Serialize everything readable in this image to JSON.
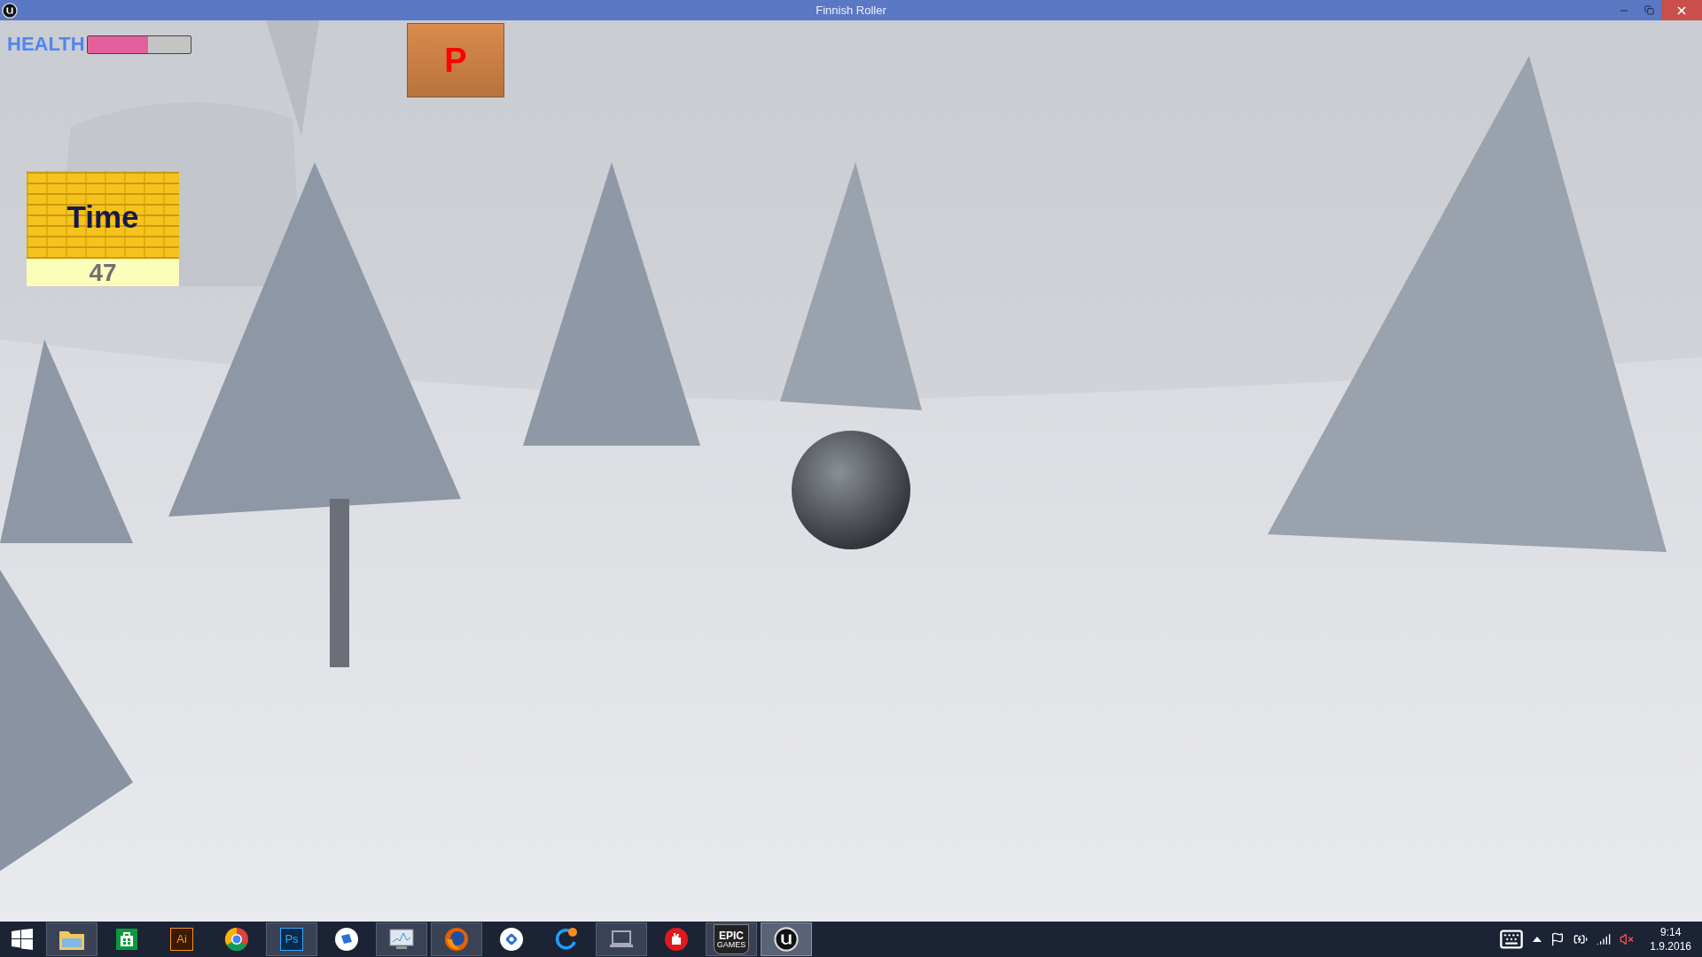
{
  "window": {
    "title": "Finnish Roller"
  },
  "hud": {
    "health": {
      "label": "HEALTH",
      "level": 0.59
    },
    "pause_button": {
      "label": "P"
    },
    "timer": {
      "label": "Time",
      "value": "47"
    }
  },
  "taskbar": {
    "apps": [
      {
        "kind": "folder",
        "running": true
      },
      {
        "kind": "store",
        "running": false
      },
      {
        "kind": "illustrator",
        "label": "Ai",
        "running": false
      },
      {
        "kind": "chrome",
        "running": false
      },
      {
        "kind": "photoshop",
        "label": "Ps",
        "running": true
      },
      {
        "kind": "share",
        "running": false
      },
      {
        "kind": "monitor",
        "running": true
      },
      {
        "kind": "firefox",
        "running": true
      },
      {
        "kind": "maps",
        "running": false
      },
      {
        "kind": "refresh",
        "running": false
      },
      {
        "kind": "laptop",
        "running": true
      },
      {
        "kind": "hand",
        "running": false
      },
      {
        "kind": "epic",
        "label": "EPIC",
        "sublabel": "GAMES",
        "running": true
      },
      {
        "kind": "unreal",
        "running": true
      }
    ],
    "clock": {
      "time": "9:14",
      "date": "1.9.2016"
    }
  }
}
